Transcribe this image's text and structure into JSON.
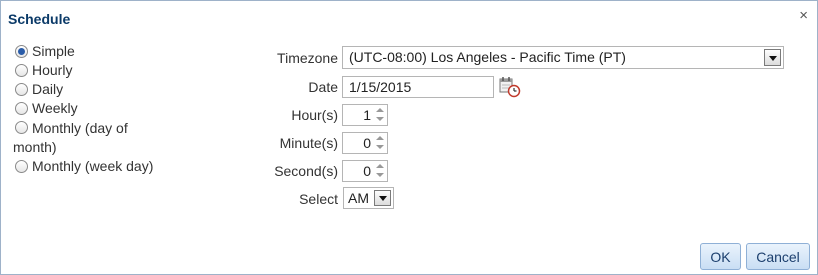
{
  "dialog": {
    "title": "Schedule",
    "close_icon": "×"
  },
  "frequency": {
    "selected": "Simple",
    "options": [
      {
        "label": "Simple",
        "selected": true
      },
      {
        "label": "Hourly",
        "selected": false
      },
      {
        "label": "Daily",
        "selected": false
      },
      {
        "label": "Weekly",
        "selected": false
      },
      {
        "label": "Monthly (day of month)",
        "selected": false
      },
      {
        "label": "Monthly (week day)",
        "selected": false
      }
    ]
  },
  "form": {
    "timezone": {
      "label": "Timezone",
      "value": "(UTC-08:00) Los Angeles - Pacific Time (PT)"
    },
    "date": {
      "label": "Date",
      "value": "1/15/2015"
    },
    "hours": {
      "label": "Hour(s)",
      "value": "1"
    },
    "minutes": {
      "label": "Minute(s)",
      "value": "0"
    },
    "seconds": {
      "label": "Second(s)",
      "value": "0"
    },
    "ampm": {
      "label": "Select",
      "value": "AM"
    }
  },
  "buttons": {
    "ok": "OK",
    "cancel": "Cancel"
  },
  "colors": {
    "title": "#0b3a68",
    "border": "#9eb2c9",
    "button_bg": "#c9def4"
  }
}
